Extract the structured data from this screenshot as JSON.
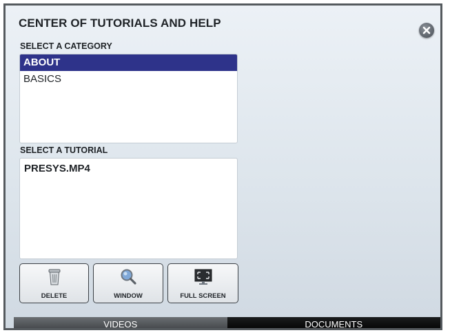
{
  "title": "CENTER OF TUTORIALS AND HELP",
  "category_section": {
    "label": "SELECT A CATEGORY",
    "items": [
      {
        "label": "ABOUT",
        "selected": true
      },
      {
        "label": "BASICS",
        "selected": false
      }
    ]
  },
  "tutorial_section": {
    "label": "SELECT A TUTORIAL",
    "items": [
      {
        "label": "PRESYS.MP4"
      }
    ]
  },
  "toolbar": {
    "delete_label": "DELETE",
    "window_label": "WINDOW",
    "fullscreen_label": "FULL SCREEN"
  },
  "tabs": [
    {
      "label": "VIDEOS",
      "active": true
    },
    {
      "label": "DOCUMENTS",
      "active": false
    }
  ],
  "icons": {
    "close": "close-icon",
    "delete": "trash-icon",
    "window": "magnifier-icon",
    "fullscreen": "fullscreen-monitor-icon"
  },
  "colors": {
    "selection": "#2e338a",
    "active_tab": "#55595d",
    "inactive_tab": "#000000"
  }
}
